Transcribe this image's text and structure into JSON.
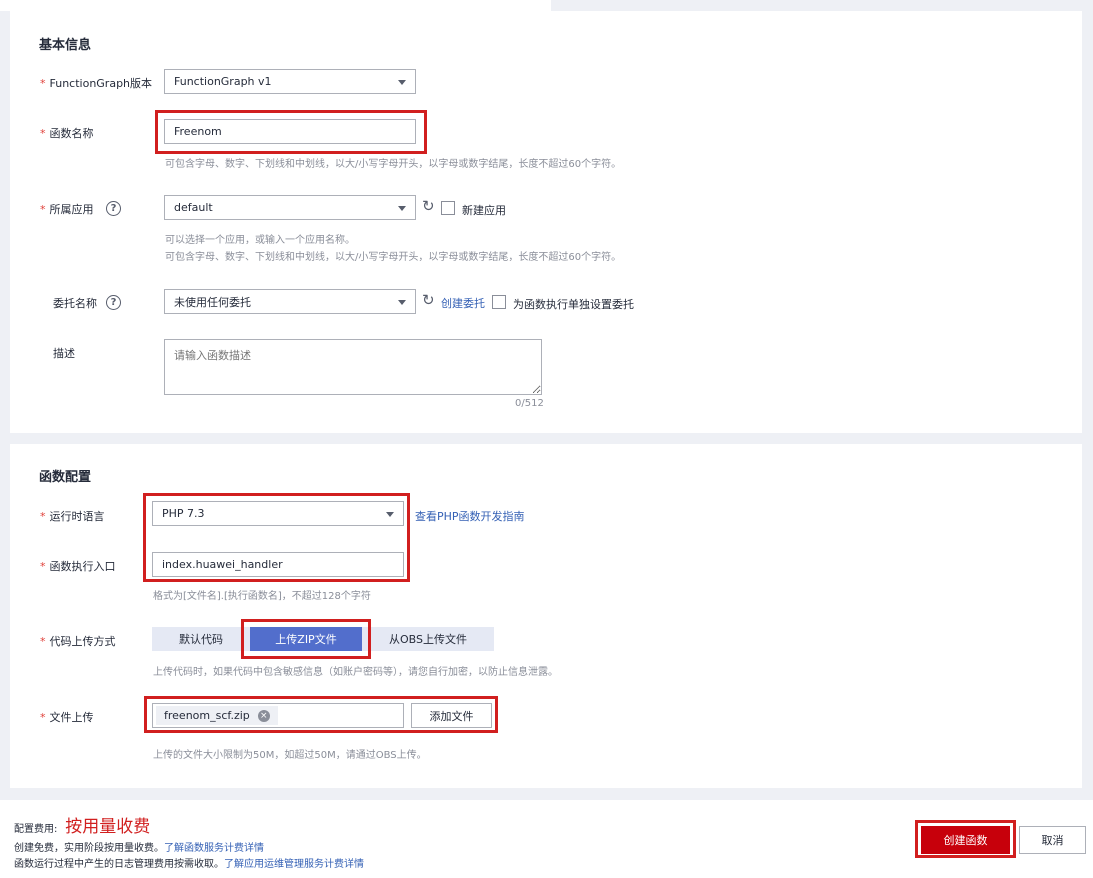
{
  "basic": {
    "title": "基本信息",
    "version": {
      "label": "FunctionGraph版本",
      "value": "FunctionGraph v1"
    },
    "name": {
      "label": "函数名称",
      "value": "Freenom",
      "hint": "可包含字母、数字、下划线和中划线，以大/小写字母开头，以字母或数字结尾，长度不超过60个字符。"
    },
    "app": {
      "label": "所属应用",
      "value": "default",
      "new_app_label": "新建应用",
      "hint1": "可以选择一个应用，或输入一个应用名称。",
      "hint2": "可包含字母、数字、下划线和中划线，以大/小写字母开头，以字母或数字结尾，长度不超过60个字符。"
    },
    "agency": {
      "label": "委托名称",
      "value": "未使用任何委托",
      "create_link": "创建委托",
      "separate_label": "为函数执行单独设置委托"
    },
    "desc": {
      "label": "描述",
      "placeholder": "请输入函数描述",
      "counter": "0/512"
    }
  },
  "config": {
    "title": "函数配置",
    "runtime": {
      "label": "运行时语言",
      "value": "PHP 7.3",
      "guide_link": "查看PHP函数开发指南"
    },
    "handler": {
      "label": "函数执行入口",
      "value": "index.huawei_handler",
      "hint": "格式为[文件名].[执行函数名]，不超过128个字符"
    },
    "upload_method": {
      "label": "代码上传方式",
      "options": [
        "默认代码",
        "上传ZIP文件",
        "从OBS上传文件"
      ],
      "selected": "上传ZIP文件",
      "hint": "上传代码时，如果代码中包含敏感信息（如账户密码等），请您自行加密，以防止信息泄露。"
    },
    "file": {
      "label": "文件上传",
      "filename": "freenom_scf.zip",
      "add_button": "添加文件",
      "hint": "上传的文件大小限制为50M，如超过50M，请通过OBS上传。"
    }
  },
  "footer": {
    "fee_label": "配置费用:",
    "fee_value": "按用量收费",
    "line1": "创建免费，实用阶段按用量收费。",
    "line1_link": "了解函数服务计费详情",
    "line2": "函数运行过程中产生的日志管理费用按需收取。",
    "line2_link": "了解应用运维管理服务计费详情",
    "create_button": "创建函数",
    "cancel_button": "取消"
  },
  "colors": {
    "accent": "#526ecc",
    "danger": "#c7000b",
    "highlight_box": "#d11f1f",
    "link": "#3561b5"
  }
}
